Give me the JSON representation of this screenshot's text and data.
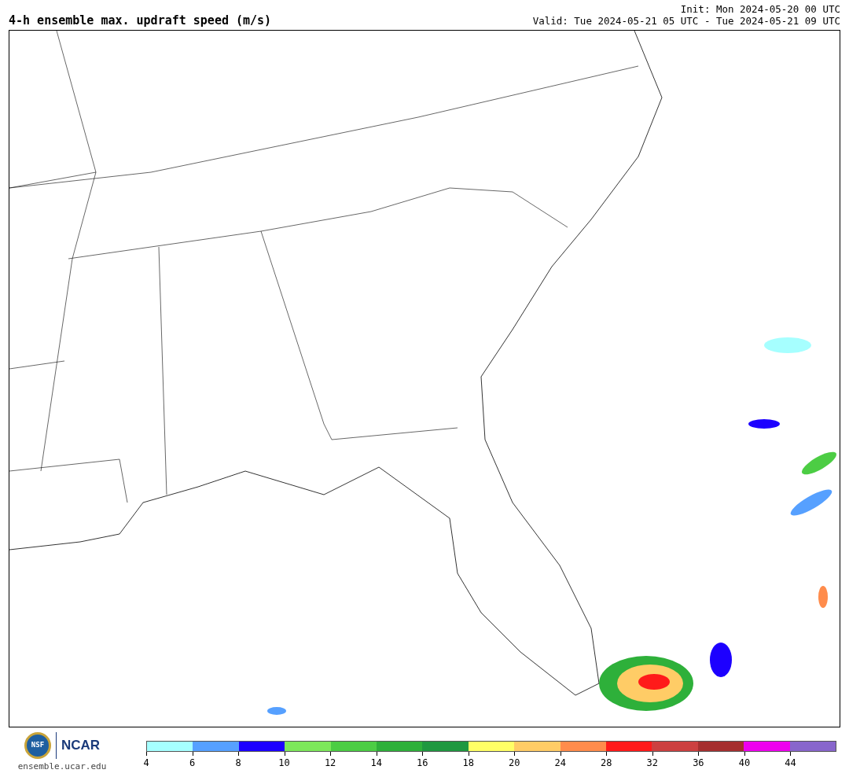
{
  "header": {
    "title": "4-h ensemble max. updraft speed (m/s)",
    "init": "Init: Mon 2024-05-20 00 UTC",
    "valid": "Valid: Tue 2024-05-21 05 UTC - Tue 2024-05-21 09 UTC"
  },
  "footer": {
    "nsf_logo": "NSF",
    "ncar_logo": "NCAR",
    "site": "ensemble.ucar.edu"
  },
  "colorbar": {
    "bins": [
      {
        "color": "#a6ffff"
      },
      {
        "color": "#56a0ff"
      },
      {
        "color": "#1d00ff"
      },
      {
        "color": "#7de85a"
      },
      {
        "color": "#4ccd44"
      },
      {
        "color": "#2eb03a"
      },
      {
        "color": "#1f9840"
      },
      {
        "color": "#ffff66"
      },
      {
        "color": "#ffcc66"
      },
      {
        "color": "#ff8c4c"
      },
      {
        "color": "#ff1a1a"
      },
      {
        "color": "#cc4040"
      },
      {
        "color": "#a52f2f"
      },
      {
        "color": "#ee00ee"
      },
      {
        "color": "#8866cc"
      }
    ],
    "ticks": [
      "4",
      "6",
      "8",
      "10",
      "12",
      "14",
      "16",
      "18",
      "20",
      "24",
      "28",
      "32",
      "36",
      "40",
      "44"
    ]
  }
}
